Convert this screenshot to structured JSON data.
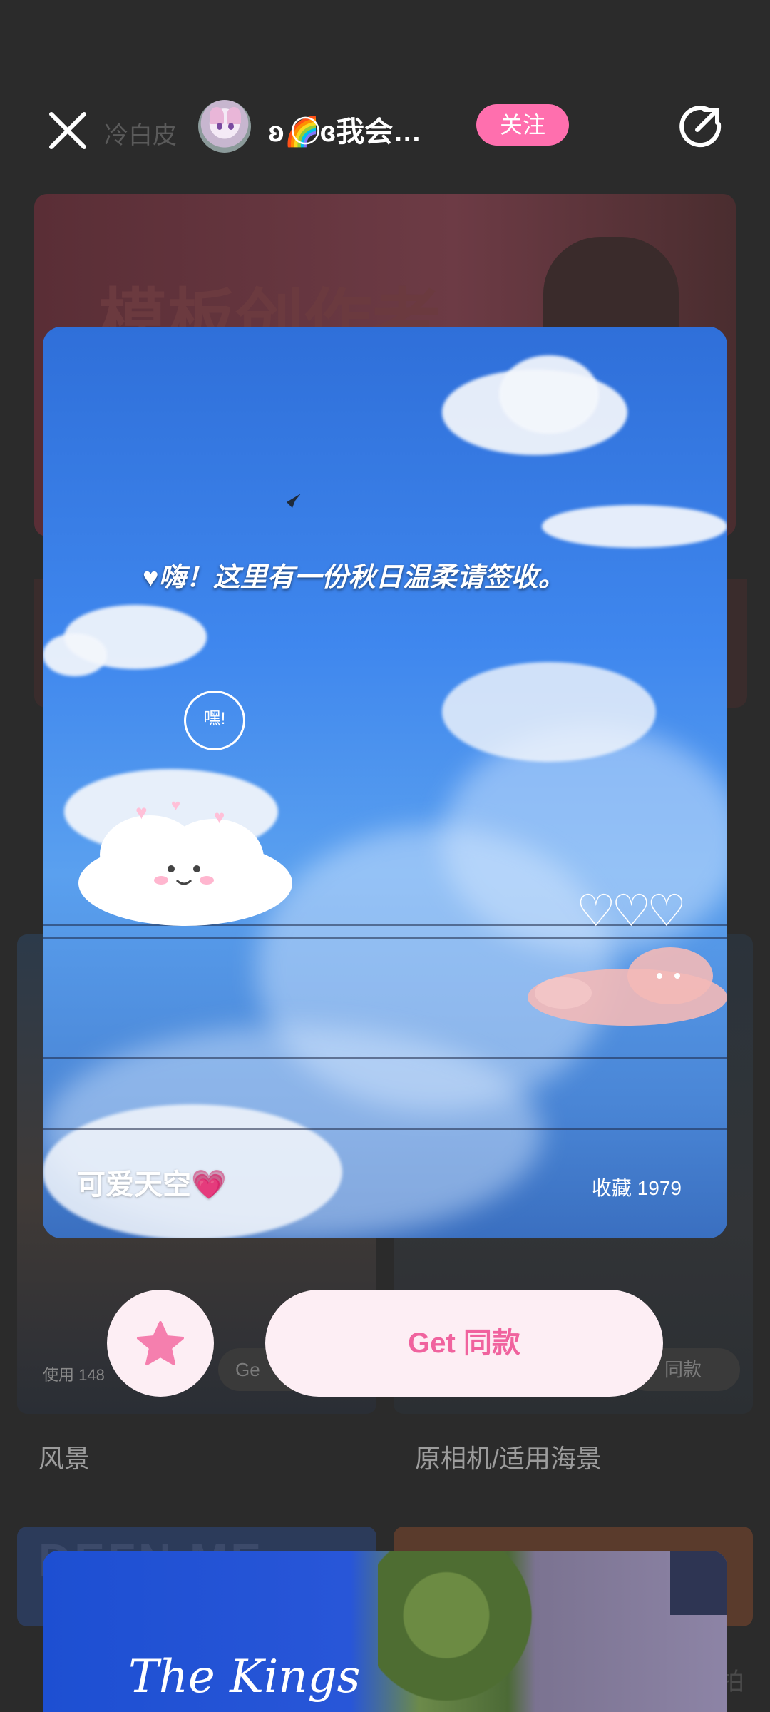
{
  "header": {
    "ghost_text": "冷白皮",
    "author_name": "ʚ🌈⃝ɞ我会…",
    "follow_label": "关注"
  },
  "background": {
    "banner_text": "模板创作者",
    "usage_text": "使用 148",
    "left_pill": "Ge",
    "right_pill": "同款",
    "left_title": "风景",
    "right_title": "原相机/适用海景",
    "card2_text": "DEFN ME",
    "side_text": "拍"
  },
  "preview": {
    "quote": "♥嗨！这里有一份秋日温柔请签收。",
    "speech_text": "嘿!",
    "title": "可爱天空",
    "title_emoji": "💗",
    "favorites_label": "收藏 1979"
  },
  "actions": {
    "get_label": "Get 同款"
  },
  "preview2": {
    "text": "The Kings"
  },
  "colors": {
    "accent_pink": "#ff6fae",
    "button_bg": "#fdeef4",
    "button_text": "#f0639e",
    "page_bg": "#2b2b2b"
  },
  "icons": [
    "close-icon",
    "share-icon",
    "star-icon",
    "bird-icon"
  ]
}
